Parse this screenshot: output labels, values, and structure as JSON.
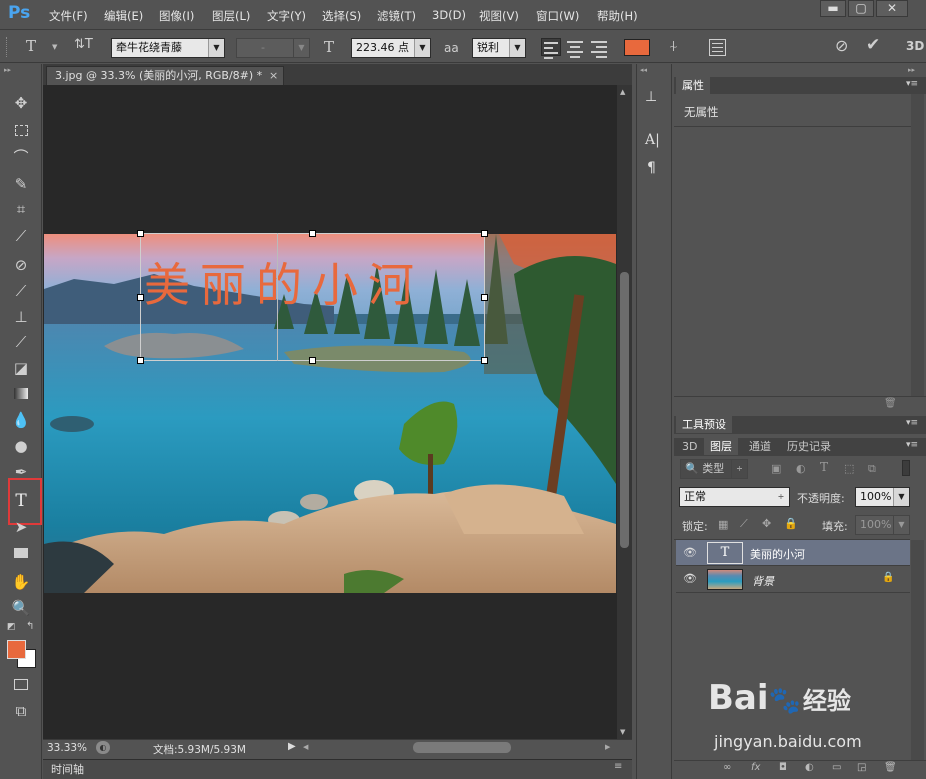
{
  "app": {
    "logo": "Ps"
  },
  "menu": [
    "文件(F)",
    "编辑(E)",
    "图像(I)",
    "图层(L)",
    "文字(Y)",
    "选择(S)",
    "滤镜(T)",
    "3D(D)",
    "视图(V)",
    "窗口(W)",
    "帮助(H)"
  ],
  "window_controls": {
    "minimize": "▬",
    "restore": "▢",
    "close": "✕"
  },
  "options": {
    "text_tool_icon": "T",
    "orient_icon": "⇅T",
    "font_family": "牵牛花绕青藤",
    "font_style": "-",
    "size_icon": "T",
    "font_size": "223.46 点",
    "aa_icon": "aa",
    "antialias": "锐利",
    "text_color": "#e8693d",
    "three_d": "3D"
  },
  "document": {
    "tab_title": "3.jpg @ 33.3% (美丽的小河, RGB/8#) *",
    "tab_close": "×",
    "overlay_text": "美丽的小河",
    "overlay_color": "#e8693d",
    "zoom": "33.33%",
    "doc_info": "文档:5.93M/5.93M",
    "timeline_label": "时间轴"
  },
  "toolbar": {
    "highlighted_tool": "T",
    "highlight_color": "#e03a3a",
    "foreground_color": "#e8693d",
    "background_color": "#ffffff"
  },
  "mini_panel": {
    "char_icon": "A|",
    "para_icon": "¶"
  },
  "properties": {
    "title": "属性",
    "content": "无属性"
  },
  "tool_presets": {
    "title": "工具预设"
  },
  "layers_panel": {
    "tabs": [
      "3D",
      "图层",
      "通道",
      "历史记录"
    ],
    "active_tab": "图层",
    "filter_kind": "类型",
    "blend_mode": "正常",
    "opacity_label": "不透明度:",
    "opacity_value": "100%",
    "lock_label": "锁定:",
    "fill_label": "填充:",
    "fill_value": "100%",
    "layers": [
      {
        "name": "美丽的小河",
        "type": "text",
        "selected": true
      },
      {
        "name": "背景",
        "type": "image",
        "selected": false,
        "locked": true
      }
    ]
  },
  "watermark": {
    "brand": "Bai",
    "brand2": "经验",
    "url": "jingyan.baidu.com"
  }
}
